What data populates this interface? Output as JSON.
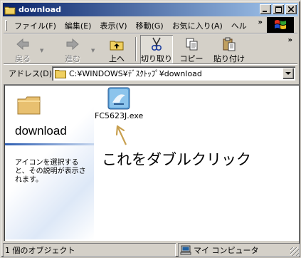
{
  "window": {
    "title": "download"
  },
  "title_buttons": {
    "minimize_glyph": "_",
    "maximize_glyph": "□",
    "close_glyph": "X"
  },
  "menu": {
    "items": [
      "ファイル(F)",
      "編集(E)",
      "表示(V)",
      "移動(G)",
      "お気に入り(A)",
      "ヘル"
    ],
    "more": "»"
  },
  "toolbar": {
    "back": "戻る",
    "forward": "進む",
    "up": "上へ",
    "cut": "切り取り",
    "copy": "コピー",
    "paste": "貼り付け",
    "more": "»"
  },
  "address": {
    "label": "アドレス(D)",
    "value": "C:¥WINDOWS¥ﾃﾞｽｸﾄｯﾌﾟ¥download"
  },
  "left_pane": {
    "folder_name": "download",
    "description": "アイコンを選択すると、その説明が表示されます。"
  },
  "file": {
    "name": "FC5623J.exe"
  },
  "annotation": {
    "text": "これをダブルクリック"
  },
  "status": {
    "objects": "1 個のオブジェクト",
    "location": "マイ コンピュータ"
  },
  "colors": {
    "titlebar_start": "#0a246a",
    "titlebar_end": "#a6caf0",
    "face": "#d4d0c8",
    "arrow": "#c8a050"
  }
}
